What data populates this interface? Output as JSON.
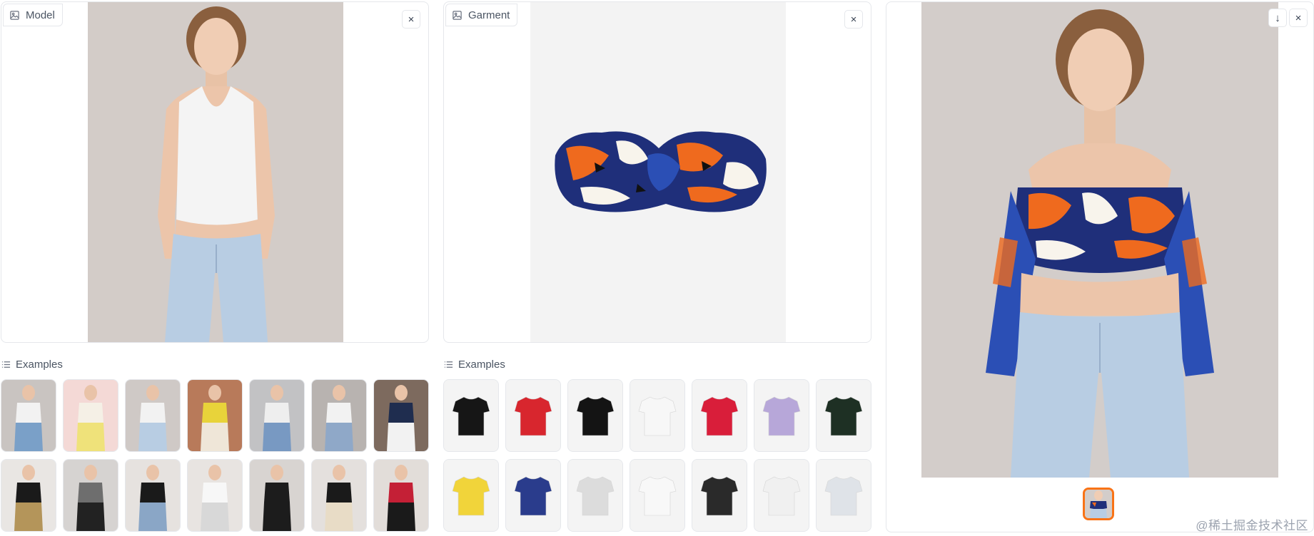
{
  "model_panel": {
    "label": "Model",
    "close_icon": "×"
  },
  "garment_panel": {
    "label": "Garment",
    "close_icon": "×"
  },
  "result_panel": {
    "download_icon": "↓",
    "close_icon": "×"
  },
  "model_examples": {
    "label": "Examples",
    "count": 14
  },
  "garment_examples": {
    "label": "Examples",
    "count": 14
  },
  "watermark": "@稀土掘金技术社区",
  "colors": {
    "accent": "#f97316",
    "border": "#e5e7eb",
    "label_text": "#4b5563"
  }
}
